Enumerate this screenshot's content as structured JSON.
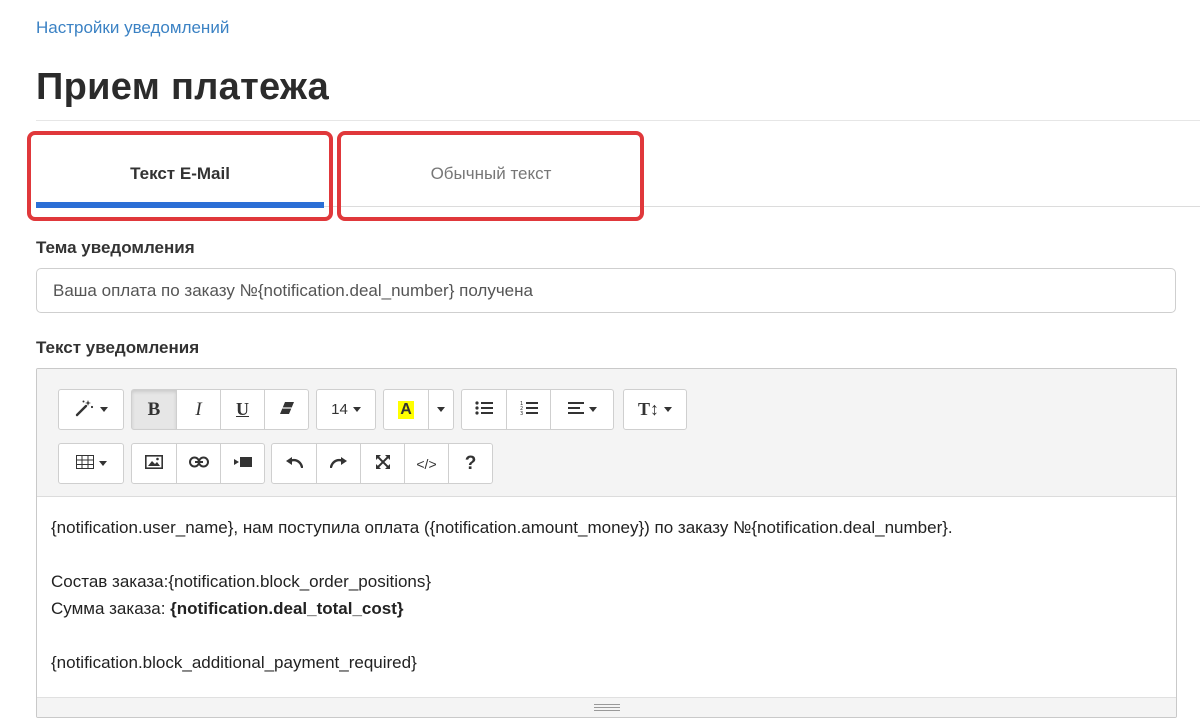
{
  "breadcrumb": "Настройки уведомлений",
  "page_title": "Прием платежа",
  "tabs": [
    {
      "label": "Текст E-Mail",
      "active": true
    },
    {
      "label": "Обычный текст",
      "active": false
    }
  ],
  "subject": {
    "label": "Тема уведомления",
    "value": "Ваша оплата по заказу №{notification.deal_number} получена"
  },
  "body": {
    "label": "Текст уведомления",
    "lines": {
      "line1": "{notification.user_name}, нам поступила оплата ({notification.amount_money}) по заказу №{notification.deal_number}.",
      "line2": "Состав заказа:{notification.block_order_positions}",
      "line3_prefix": "Сумма заказа: ",
      "line3_bold": "{notification.deal_total_cost}",
      "line4": "{notification.block_additional_payment_required}"
    }
  },
  "toolbar": {
    "font_size": "14",
    "bold_glyph": "B",
    "italic_glyph": "I",
    "underline_glyph": "U",
    "highlight_glyph": "A",
    "text_style_glyph": "T↕",
    "code_glyph": "</>",
    "help_glyph": "?"
  },
  "colors": {
    "accent": "#2b6fd6",
    "link": "#3b82c4",
    "highlight_box": "#e0383b",
    "marker": "#ffff00"
  }
}
